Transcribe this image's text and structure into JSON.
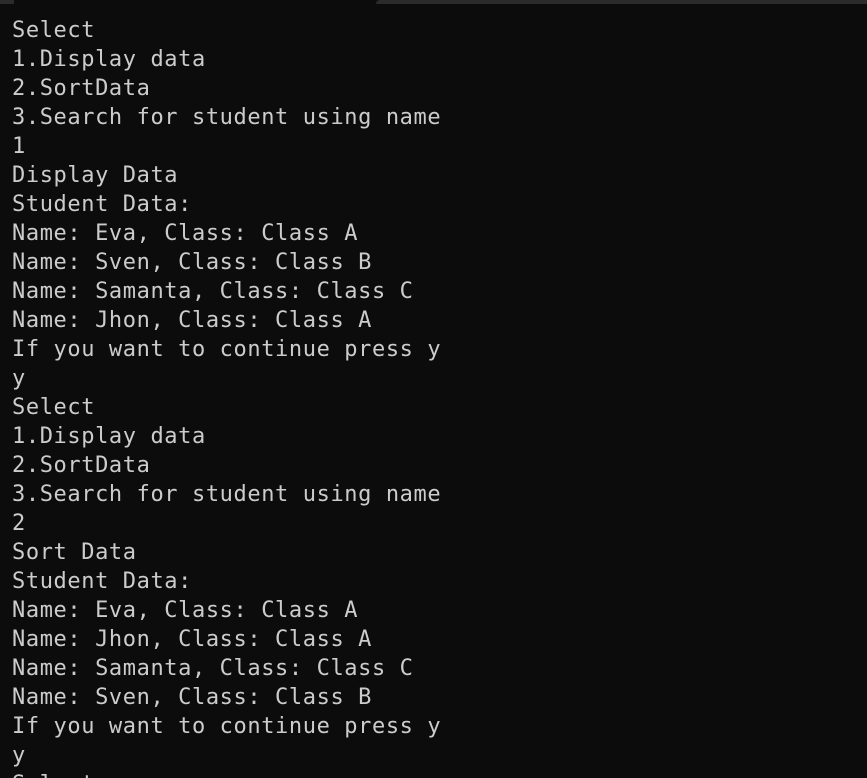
{
  "terminal": {
    "lines": [
      "Select",
      "1.Display data",
      "2.SortData",
      "3.Search for student using name",
      "1",
      "Display Data",
      "Student Data:",
      "Name: Eva, Class: Class A",
      "Name: Sven, Class: Class B",
      "Name: Samanta, Class: Class C",
      "Name: Jhon, Class: Class A",
      "If you want to continue press y",
      "y",
      "Select",
      "1.Display data",
      "2.SortData",
      "3.Search for student using name",
      "2",
      "Sort Data",
      "Student Data:",
      "Name: Eva, Class: Class A",
      "Name: Jhon, Class: Class A",
      "Name: Samanta, Class: Class C",
      "Name: Sven, Class: Class B",
      "If you want to continue press y",
      "y",
      "Select"
    ]
  },
  "colors": {
    "background": "#0c0c0c",
    "foreground": "#cccccc"
  }
}
